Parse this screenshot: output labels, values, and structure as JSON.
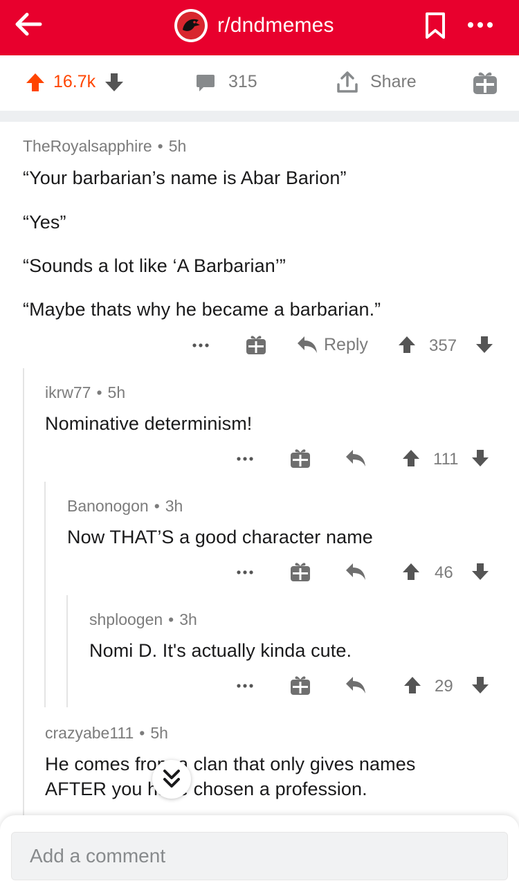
{
  "header": {
    "subreddit": "r/dndmemes",
    "brand_color": "#e8002d"
  },
  "post_actions": {
    "score": "16.7k",
    "comment_count": "315",
    "share_label": "Share",
    "score_color": "#ff4500"
  },
  "comments": [
    {
      "author": "TheRoyalsapphire",
      "age": "5h",
      "lines": [
        "“Your barbarian’s name is Abar Barion”",
        "“Yes”",
        "“Sounds a lot like ‘A Barbarian’”",
        "“Maybe thats why he became a barbarian.”"
      ],
      "reply_label": "Reply",
      "score": "357"
    },
    {
      "author": "ikrw77",
      "age": "5h",
      "lines": [
        "Nominative determinism!"
      ],
      "score": "111"
    },
    {
      "author": "Banonogon",
      "age": "3h",
      "lines": [
        "Now THAT’S a good character name"
      ],
      "score": "46"
    },
    {
      "author": "shploogen",
      "age": "3h",
      "lines": [
        "Nomi D. It's actually kinda cute."
      ],
      "score": "29"
    },
    {
      "author": "crazyabe111",
      "age": "5h",
      "lines": [
        "He comes from a clan that only gives names",
        "AFTER you have chosen a profession."
      ]
    }
  ],
  "separator": "•",
  "composer": {
    "placeholder": "Add a comment"
  },
  "icons": {
    "back": "arrow-left",
    "bookmark": "bookmark",
    "more": "ellipsis",
    "upvote": "arrow-up",
    "downvote": "arrow-down",
    "comment": "speech-bubble",
    "share": "share-upload",
    "award": "gift",
    "reply": "reply-arrow",
    "scroll": "double-chevron-down"
  }
}
